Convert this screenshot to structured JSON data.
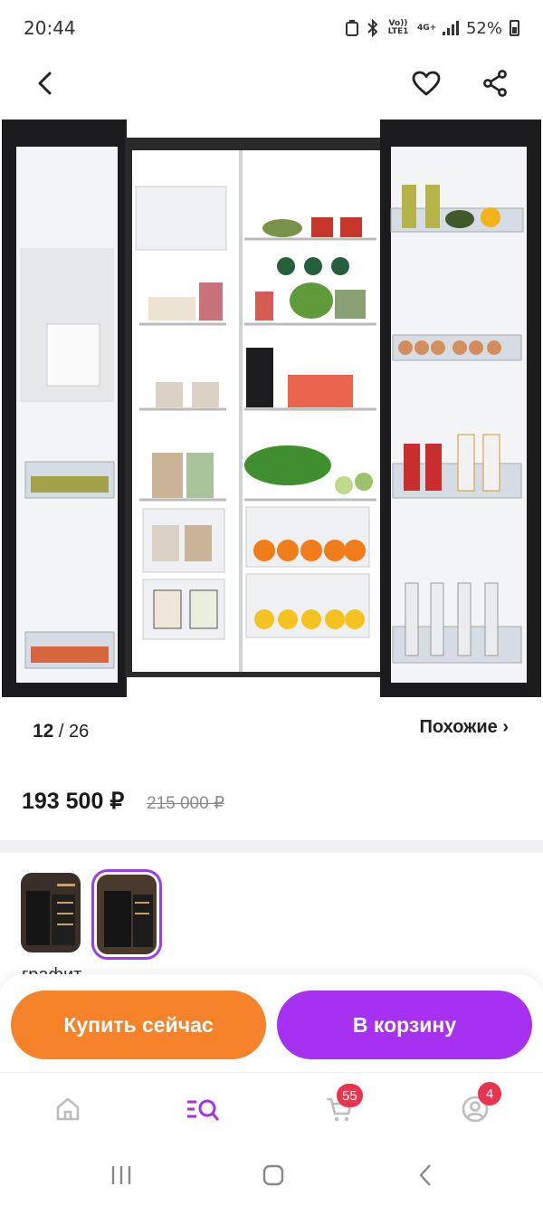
{
  "status_bar": {
    "time": "20:44",
    "network_volte": "Vo)) LTE1",
    "network_type": "4G+",
    "battery": "52%"
  },
  "top_bar": {
    "icons": [
      "back-arrow-icon",
      "heart-icon",
      "share-icon"
    ]
  },
  "gallery": {
    "current": "12",
    "total": "/ 26",
    "similar_label": "Похожие ›"
  },
  "price": {
    "current": "193 500 ₽",
    "old": "215 000 ₽"
  },
  "variants": {
    "selected_name": "графит"
  },
  "actions": {
    "buy_now": "Купить сейчас",
    "add_to_cart": "В корзину"
  },
  "tab_bar": {
    "cart_badge": "55",
    "profile_badge": "4",
    "active_color": "#a631f0"
  },
  "colors": {
    "buy_button": "#f6822a",
    "cart_button": "#a631f0",
    "badge": "#e8344e"
  }
}
